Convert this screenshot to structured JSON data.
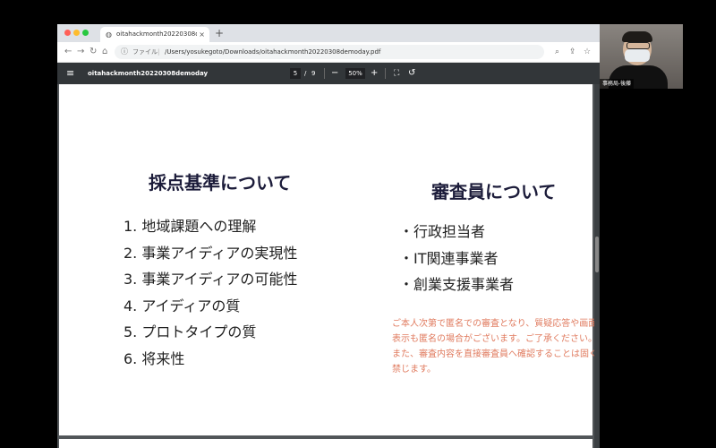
{
  "browser": {
    "tab_title": "oitahackmonth20220308demod",
    "tab_close": "×",
    "new_tab": "+",
    "address_label": "ファイル",
    "address_sep": "|",
    "url": "/Users/yosukegoto/Downloads/oitahackmonth20220308demoday.pdf"
  },
  "pdf_toolbar": {
    "file_name": "oitahackmonth20220308demoday",
    "current_page": "5",
    "page_sep": "/",
    "total_pages": "9",
    "zoom": "50%"
  },
  "slide": {
    "left_heading": "採点基準について",
    "criteria": [
      "1. 地域課題への理解",
      "2. 事業アイディアの実現性",
      "3. 事業アイディアの可能性",
      "4. アイディアの質",
      "5. プロトタイプの質",
      "6. 将来性"
    ],
    "right_heading": "審査員について",
    "judges": [
      "・行政担当者",
      "・IT関連事業者",
      "・創業支援事業者"
    ],
    "note": "ご本人次第で匿名での審査となり、質疑応答や画面表示も匿名の場合がございます。ご了承ください。また、審査内容を直接審査員へ確認することは固く禁じます。"
  },
  "video": {
    "participant_name": "事務局-後藤"
  },
  "colors": {
    "heading": "#1c1c3a",
    "note": "#e07b5f",
    "pdf_bar": "#323639",
    "viewer_bg": "#525659"
  }
}
